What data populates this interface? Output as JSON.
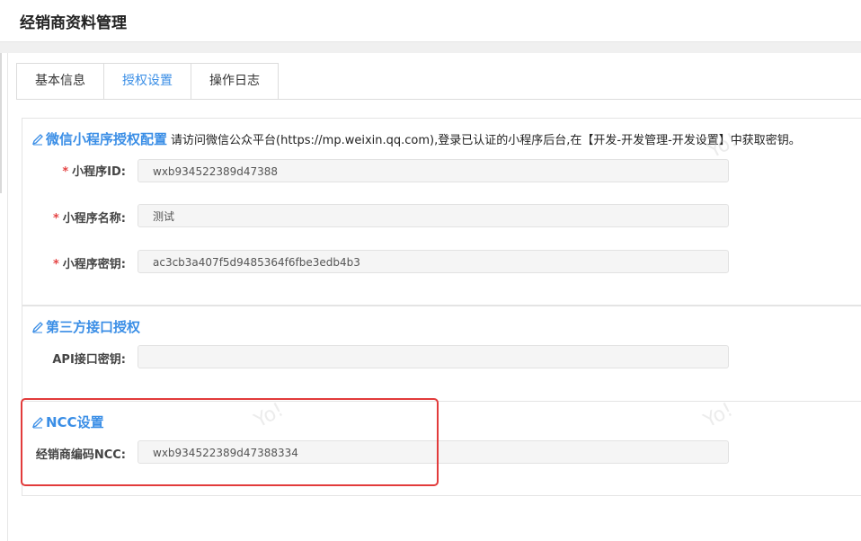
{
  "header": {
    "title": "经销商资料管理"
  },
  "tabs": [
    {
      "label": "基本信息",
      "active": false
    },
    {
      "label": "授权设置",
      "active": true
    },
    {
      "label": "操作日志",
      "active": false
    }
  ],
  "wechat_section": {
    "title": "微信小程序授权配置",
    "note": "请访问微信公众平台(https://mp.weixin.qq.com),登录已认证的小程序后台,在【开发-开发管理-开发设置】中获取密钥。",
    "fields": [
      {
        "label": "小程序ID:",
        "required": true,
        "value": "wxb934522389d47388"
      },
      {
        "label": "小程序名称:",
        "required": true,
        "value": "测试"
      },
      {
        "label": "小程序密钥:",
        "required": true,
        "value": "ac3cb3a407f5d9485364f6fbe3edb4b3"
      }
    ]
  },
  "api_section": {
    "title": "第三方接口授权",
    "fields": [
      {
        "label": "API接口密钥:",
        "required": false,
        "value": ""
      }
    ]
  },
  "ncc_section": {
    "title": "NCC设置",
    "fields": [
      {
        "label": "经销商编码NCC:",
        "required": false,
        "value": "wxb934522389d47388334"
      }
    ]
  },
  "required_mark": "*",
  "watermark_text": "Yo!",
  "colors": {
    "accent": "#3a8ee6",
    "required": "#e54545",
    "highlight_box": "#e23b3b"
  },
  "icons": {
    "section_icon": "pencil-icon"
  }
}
